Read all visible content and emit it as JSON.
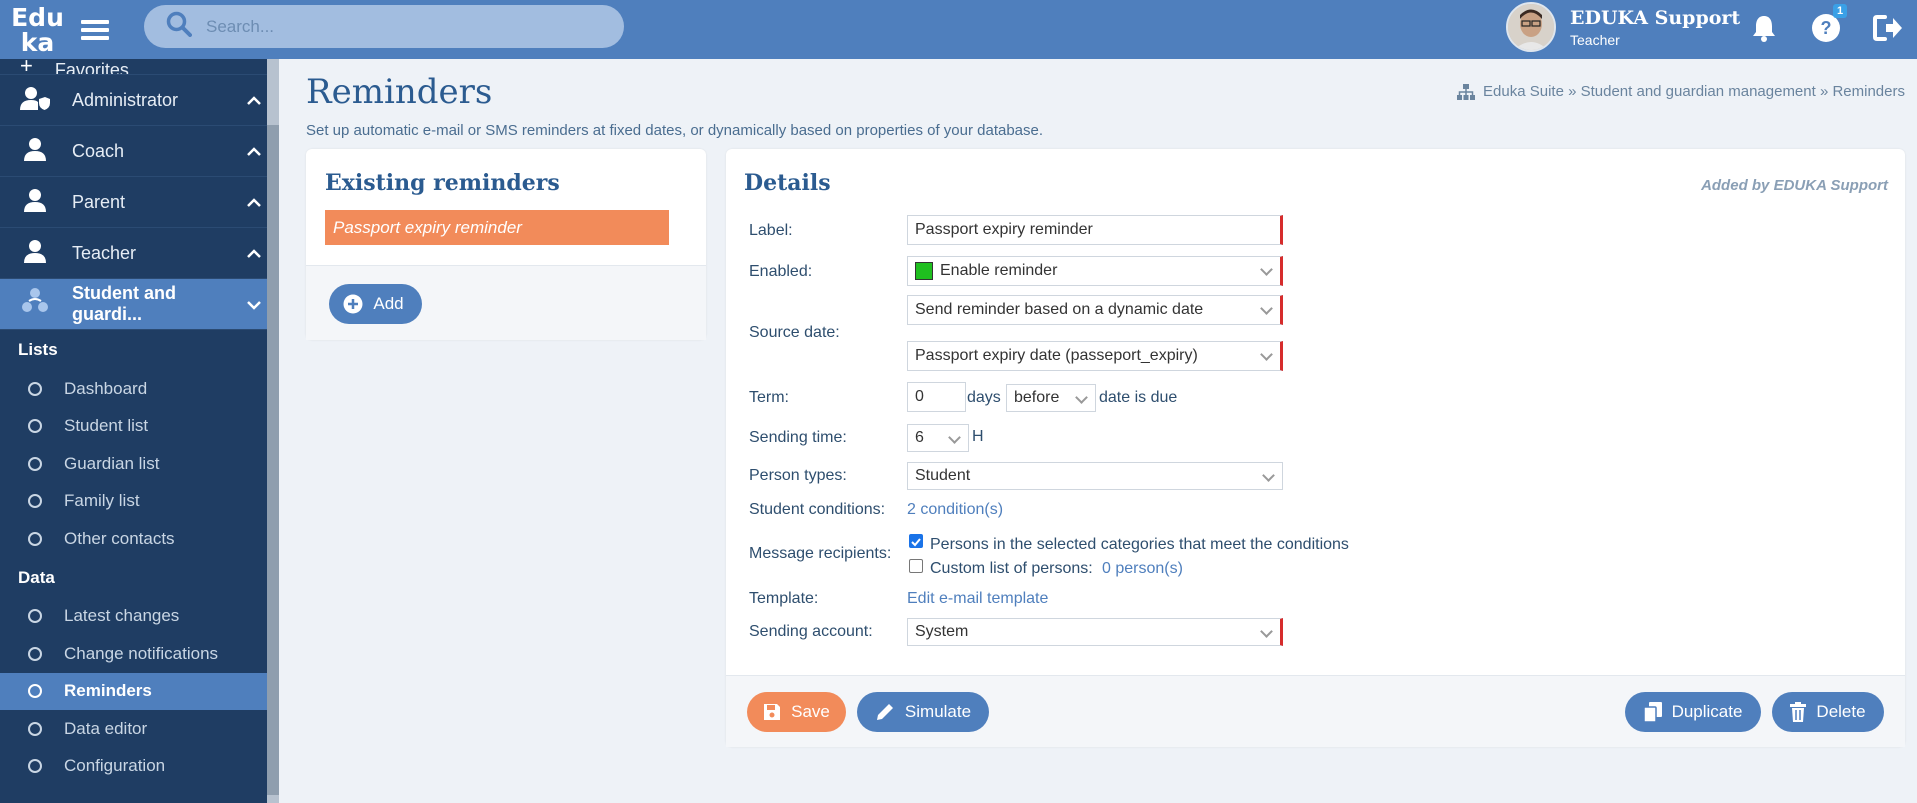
{
  "app": {
    "logo_line1": "Edu",
    "logo_line2": "ka",
    "search_placeholder": "Search...",
    "user_name": "EDUKA Support",
    "user_role": "Teacher",
    "help_badge": "1"
  },
  "sidebar": {
    "partial_item": "Favorites",
    "roles": [
      {
        "label": "Administrator"
      },
      {
        "label": "Coach"
      },
      {
        "label": "Parent"
      },
      {
        "label": "Teacher"
      },
      {
        "label": "Student and guardi..."
      }
    ],
    "sections": [
      {
        "title": "Lists",
        "items": [
          "Dashboard",
          "Student list",
          "Guardian list",
          "Family list",
          "Other contacts"
        ]
      },
      {
        "title": "Data",
        "items": [
          "Latest changes",
          "Change notifications",
          "Reminders",
          "Data editor",
          "Configuration"
        ]
      }
    ],
    "active_item": "Reminders"
  },
  "page": {
    "title": "Reminders",
    "subtitle": "Set up automatic e-mail or SMS reminders at fixed dates, or dynamically based on properties of your database.",
    "breadcrumb": "Eduka Suite » Student and guardian management » Reminders"
  },
  "existing": {
    "title": "Existing reminders",
    "items": [
      "Passport expiry reminder"
    ],
    "add_label": "Add"
  },
  "details": {
    "title": "Details",
    "added_by": "Added by EDUKA Support",
    "label_label": "Label:",
    "label_value": "Passport expiry reminder",
    "enabled_label": "Enabled:",
    "enabled_value": "Enable reminder",
    "enabled_color": "#1fbf1f",
    "source_label": "Source date:",
    "source_mode": "Send reminder based on a dynamic date",
    "source_field": "Passport expiry date (passeport_expiry)",
    "term_label": "Term:",
    "term_value": "0",
    "term_days": "days",
    "term_direction": "before",
    "term_suffix": "date is due",
    "sending_time_label": "Sending time:",
    "sending_time_value": "6",
    "sending_time_unit": "H",
    "person_types_label": "Person types:",
    "person_types_value": "Student",
    "conditions_label": "Student conditions:",
    "conditions_value": "2 condition(s)",
    "recipients_label": "Message recipients:",
    "recipient_option1": "Persons in the selected categories that meet the conditions",
    "recipient_option1_checked": true,
    "recipient_option2": "Custom list of persons:",
    "recipient_option2_checked": false,
    "recipient_option2_count": "0 person(s)",
    "template_label": "Template:",
    "template_link": "Edit e-mail template",
    "sending_account_label": "Sending account:",
    "sending_account_value": "System"
  },
  "actions": {
    "save": "Save",
    "simulate": "Simulate",
    "duplicate": "Duplicate",
    "delete": "Delete"
  },
  "colors": {
    "header": "#4f7fbd",
    "sidebar": "#1f3d63",
    "accent_orange": "#f28b5a",
    "required_marker": "#d62c2c"
  }
}
